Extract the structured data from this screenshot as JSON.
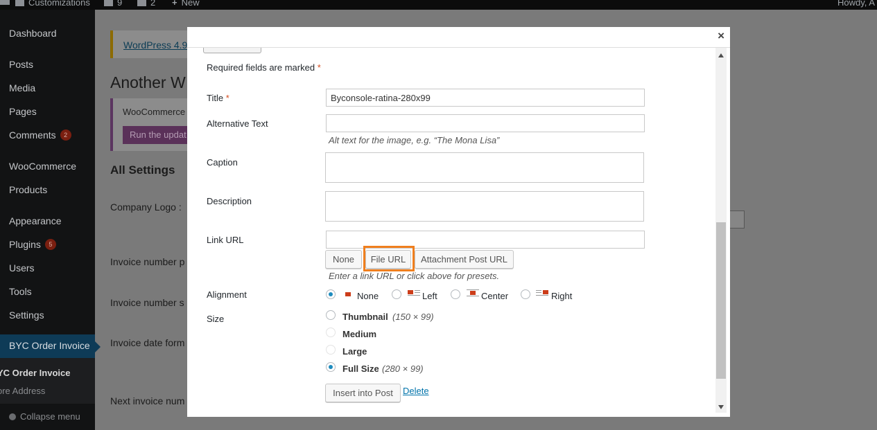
{
  "admin_bar": {
    "site_name": "Customizations",
    "updates_count": "9",
    "comments_count": "2",
    "new_label": "New",
    "howdy": "Howdy, A"
  },
  "sidebar": {
    "items": [
      {
        "label": "Dashboard"
      },
      {
        "label": "Posts"
      },
      {
        "label": "Media"
      },
      {
        "label": "Pages"
      },
      {
        "label": "Comments",
        "badge": "2"
      },
      {
        "label": "WooCommerce"
      },
      {
        "label": "Products"
      },
      {
        "label": "Appearance"
      },
      {
        "label": "Plugins",
        "badge": "5"
      },
      {
        "label": "Users"
      },
      {
        "label": "Tools"
      },
      {
        "label": "Settings"
      }
    ],
    "active": "BYC Order Invoice",
    "submenu": [
      "YC Order Invoice",
      "ore Address"
    ],
    "collapse": "Collapse menu"
  },
  "background": {
    "update_notice": "WordPress 4.9.",
    "page_heading": "Another W",
    "woo_notice": "WooCommerce",
    "woo_button": "Run the updat",
    "section_title": "All Settings",
    "fields": [
      "Company Logo :",
      "Invoice number p",
      "Invoice number s",
      "Invoice date form",
      "Next invoice num"
    ]
  },
  "modal": {
    "close_label": "×",
    "required_note": "Required fields are marked",
    "required_mark": "*",
    "title_label": "Title",
    "title_value": "Byconsole-ratina-280x99",
    "alt_label": "Alternative Text",
    "alt_value": "",
    "alt_help": "Alt text for the image, e.g. “The Mona Lisa”",
    "caption_label": "Caption",
    "description_label": "Description",
    "link_label": "Link URL",
    "link_value": "",
    "link_buttons": [
      "None",
      "File URL",
      "Attachment Post URL"
    ],
    "link_help": "Enter a link URL or click above for presets.",
    "alignment_label": "Alignment",
    "alignment_options": [
      "None",
      "Left",
      "Center",
      "Right"
    ],
    "alignment_selected": "None",
    "size_label": "Size",
    "size_options": [
      {
        "label": "Thumbnail",
        "dims": "(150 × 99)"
      },
      {
        "label": "Medium",
        "dims": ""
      },
      {
        "label": "Large",
        "dims": ""
      },
      {
        "label": "Full Size",
        "dims": "(280 × 99)"
      }
    ],
    "size_selected": "Full Size",
    "insert_button": "Insert into Post",
    "delete_link": "Delete"
  },
  "colors": {
    "highlight": "#f07f1e",
    "link": "#0073aa",
    "radio_checked": "#1e8cbe"
  }
}
